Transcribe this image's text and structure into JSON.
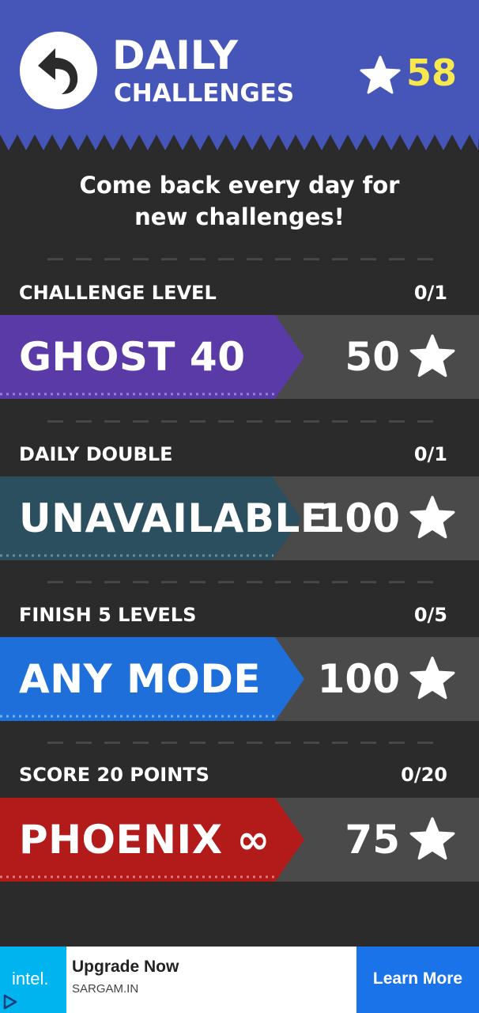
{
  "header": {
    "title_line1": "DAILY",
    "title_line2": "CHALLENGES",
    "star_total": "58",
    "back_icon": "back-arrow-icon",
    "star_icon": "star-icon"
  },
  "subtitle": "Come back every day for new challenges!",
  "challenges": [
    {
      "label": "CHALLENGE LEVEL",
      "progress": "0/1",
      "name": "GHOST 40",
      "reward": "50",
      "color": "#5a3aa6"
    },
    {
      "label": "DAILY DOUBLE",
      "progress": "0/1",
      "name": "UNAVAILABLE",
      "reward": "100",
      "color": "#2b4f5e"
    },
    {
      "label": "FINISH 5 LEVELS",
      "progress": "0/5",
      "name": "ANY MODE",
      "reward": "100",
      "color": "#1e6fd9"
    },
    {
      "label": "SCORE 20 POINTS",
      "progress": "0/20",
      "name": "PHOENIX ∞",
      "reward": "75",
      "color": "#b31a1a"
    }
  ],
  "ad": {
    "logo": "intel.",
    "title": "Upgrade Now",
    "domain": "SARGAM.IN",
    "cta": "Learn More"
  },
  "colors": {
    "header_bg": "#4556b8",
    "body_bg": "#2b2b2b",
    "star_count": "#f7e94d",
    "reward_bg": "#4a4a4a"
  }
}
